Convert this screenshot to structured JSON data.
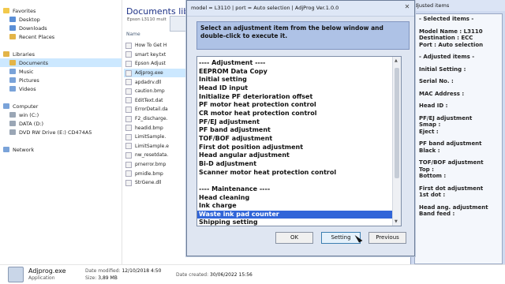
{
  "explorer": {
    "library_title": "Documents libra",
    "library_sub": "Epson L3110 mult",
    "column_name": "Name",
    "nav": [
      {
        "label": "Favorites",
        "indent": 4,
        "color": "#f2c94c"
      },
      {
        "label": "Desktop",
        "indent": 12,
        "color": "#5b8fd6"
      },
      {
        "label": "Downloads",
        "indent": 12,
        "color": "#5b8fd6"
      },
      {
        "label": "Recent Places",
        "indent": 12,
        "color": "#e3b448"
      },
      {
        "label": "",
        "indent": 0,
        "color": "transparent"
      },
      {
        "label": "Libraries",
        "indent": 4,
        "color": "#e3b448"
      },
      {
        "label": "Documents",
        "indent": 12,
        "color": "#e3b448",
        "selected": true
      },
      {
        "label": "Music",
        "indent": 12,
        "color": "#7aa3d9"
      },
      {
        "label": "Pictures",
        "indent": 12,
        "color": "#7aa3d9"
      },
      {
        "label": "Videos",
        "indent": 12,
        "color": "#7aa3d9"
      },
      {
        "label": "",
        "indent": 0,
        "color": "transparent"
      },
      {
        "label": "Computer",
        "indent": 4,
        "color": "#7aa3d9"
      },
      {
        "label": "win (C:)",
        "indent": 12,
        "color": "#9aa6b5"
      },
      {
        "label": "DATA (D:)",
        "indent": 12,
        "color": "#9aa6b5"
      },
      {
        "label": "DVD RW Drive (E:) CD474A5",
        "indent": 12,
        "color": "#9aa6b5"
      },
      {
        "label": "",
        "indent": 0,
        "color": "transparent"
      },
      {
        "label": "Network",
        "indent": 4,
        "color": "#7aa3d9"
      }
    ],
    "files": [
      "How To Get H",
      "smart key.txt",
      "Epson Adjust",
      "Adjprog.exe",
      "apdadrv.dll",
      "caution.bmp",
      "EditText.dat",
      "ErrorDetail.da",
      "F2_discharge.",
      "headid.bmp",
      "LimitSample.",
      "LimitSample.e",
      "nw_resetdata.",
      "prnerror.bmp",
      "pmidle.bmp",
      "StrGene.dll"
    ],
    "status": {
      "name": "Adjprog.exe",
      "type": "Application",
      "modified_label": "Date modified:",
      "modified": "12/10/2018 4:50",
      "size_label": "Size:",
      "size": "3,89 MB",
      "created_label": "Date created:",
      "created": "30/06/2022 15:56"
    }
  },
  "right_panel": {
    "title": "djusted items",
    "lines": [
      "- Selected items -",
      "",
      "Model Name : L3110",
      "Destination : ECC",
      "Port : Auto selection",
      "",
      "- Adjusted items -",
      "",
      "Initial Setting :",
      "",
      "Serial No. :",
      "",
      "MAC Address :",
      "",
      "Head ID :",
      "",
      "PF/EJ adjustment",
      " Smap :",
      " Eject :",
      "",
      "PF band adjustment",
      " Black :",
      "",
      "TOF/BOF adjustment",
      " Top :",
      " Bottom :",
      "",
      "First dot adjustment",
      " 1st dot :",
      "",
      "Head ang. adjustment",
      " Band feed :"
    ]
  },
  "dialog": {
    "title": "model = L3110 | port = Auto selection | AdjProg Ver.1.0.0",
    "close": "✕",
    "instruction": "Select an adjustment item from the below window and double-click to execute it.",
    "items": [
      "---- Adjustment ----",
      "EEPROM Data Copy",
      "Initial setting",
      "Head ID input",
      "Initialize PF deterioration offset",
      "PF motor heat protection control",
      "CR motor heat protection control",
      "PF/EJ adjustment",
      "PF band adjustment",
      "TOF/BOF adjustment",
      "First dot position adjustment",
      "Head angular adjustment",
      "Bi-D adjustment",
      "Scanner motor heat protection control",
      "",
      "---- Maintenance ----",
      "Head cleaning",
      "Ink charge",
      "Waste ink pad counter",
      "Shipping setting"
    ],
    "selected_index": 18,
    "buttons": {
      "ok": "OK",
      "setting": "Setting",
      "previous": "Previous"
    }
  }
}
